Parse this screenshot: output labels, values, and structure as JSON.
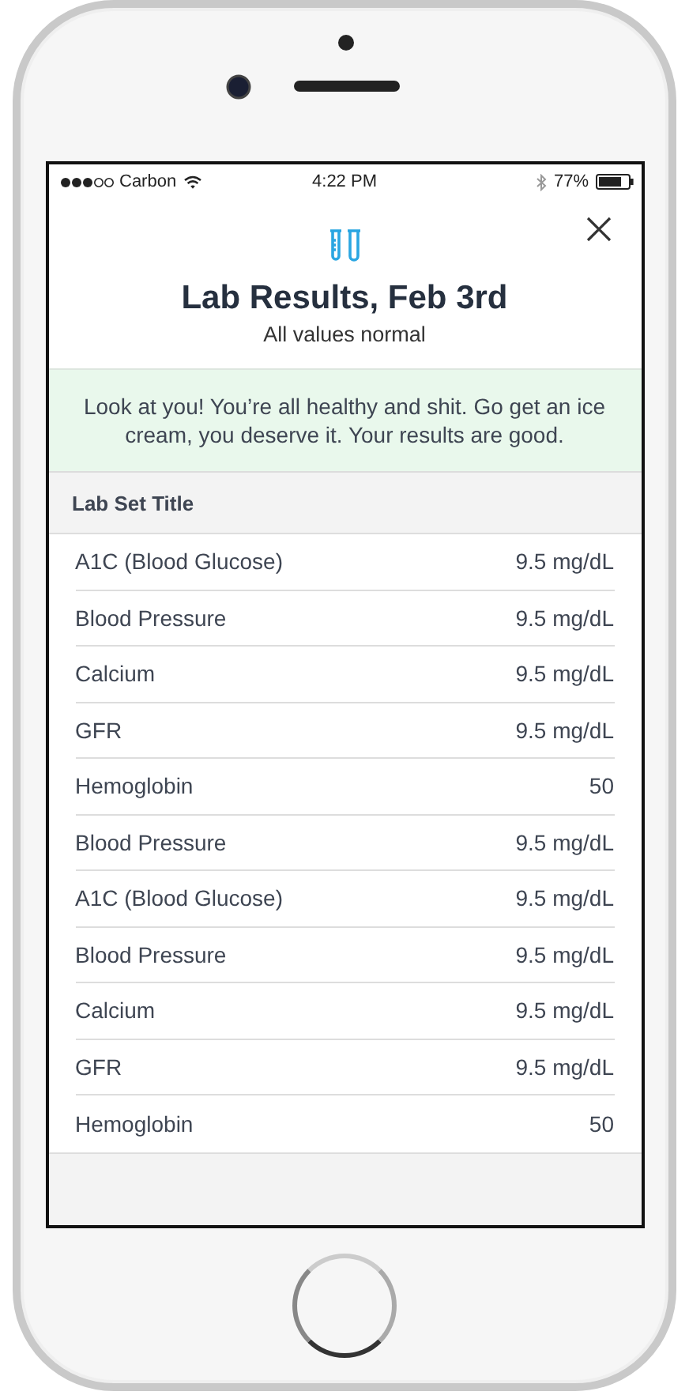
{
  "status_bar": {
    "carrier": "Carbon",
    "time": "4:22 PM",
    "battery": "77%"
  },
  "header": {
    "title": "Lab Results, Feb 3rd",
    "subtitle": "All values normal"
  },
  "banner": {
    "text": "Look at you! You’re all healthy and shit. Go get an ice cream, you deserve it. Your results are good."
  },
  "lab_set": {
    "title": "Lab Set Title",
    "rows": [
      {
        "name": "A1C (Blood Glucose)",
        "value": "9.5 mg/dL"
      },
      {
        "name": "Blood Pressure",
        "value": "9.5 mg/dL"
      },
      {
        "name": "Calcium",
        "value": "9.5 mg/dL"
      },
      {
        "name": "GFR",
        "value": "9.5 mg/dL"
      },
      {
        "name": "Hemoglobin",
        "value": "50"
      },
      {
        "name": "Blood Pressure",
        "value": "9.5 mg/dL"
      },
      {
        "name": "A1C (Blood Glucose)",
        "value": "9.5 mg/dL"
      },
      {
        "name": "Blood Pressure",
        "value": "9.5 mg/dL"
      },
      {
        "name": "Calcium",
        "value": "9.5 mg/dL"
      },
      {
        "name": "GFR",
        "value": "9.5 mg/dL"
      },
      {
        "name": "Hemoglobin",
        "value": "50"
      }
    ]
  }
}
